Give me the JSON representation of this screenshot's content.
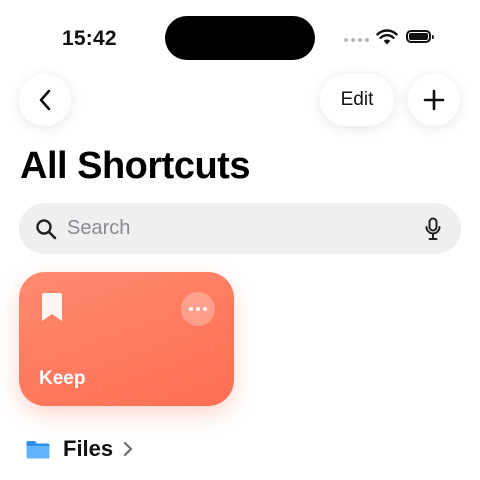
{
  "status_bar": {
    "time": "15:42"
  },
  "nav": {
    "edit_label": "Edit"
  },
  "page": {
    "title": "All Shortcuts"
  },
  "search": {
    "placeholder": "Search",
    "value": ""
  },
  "shortcuts": [
    {
      "title": "Keep",
      "icon": "bookmark-icon",
      "color": "#ff7a5e"
    }
  ],
  "folders": [
    {
      "label": "Files",
      "icon": "folder-icon",
      "color": "#3b9ef5"
    }
  ]
}
